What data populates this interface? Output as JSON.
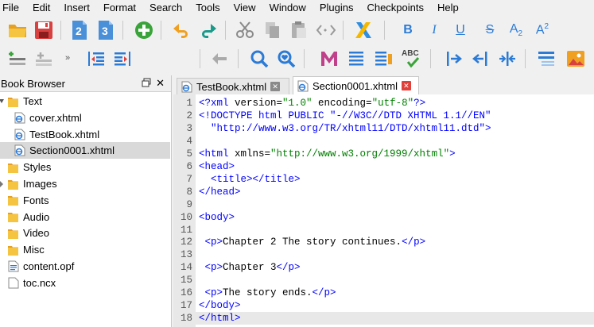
{
  "menu": [
    "File",
    "Edit",
    "Insert",
    "Format",
    "Search",
    "Tools",
    "View",
    "Window",
    "Plugins",
    "Checkpoints",
    "Help"
  ],
  "toolbar1_icons": [
    "open-folder-icon",
    "save-icon",
    "heading-2-icon",
    "heading-3-icon",
    "add-file-icon",
    "undo-icon",
    "redo-icon",
    "cut-icon",
    "copy-icon",
    "paste-icon",
    "code-view-icon",
    "x-logo-icon",
    "bold-icon",
    "italic-icon",
    "underline-icon",
    "strikethrough-icon",
    "subscript-icon",
    "superscript-icon"
  ],
  "toolbar1_labels": {
    "h2": "2",
    "h3": "3",
    "bold": "B",
    "italic": "I",
    "underline": "U",
    "strike": "S",
    "sub": "A",
    "sub_mark": "2",
    "sup": "A",
    "sup_mark": "2"
  },
  "toolbar2_icons": [
    "insert-row-icon",
    "remove-row-icon",
    "more-chevron-icon",
    "decrease-indent-icon",
    "increase-indent-icon",
    "back-arrow-icon",
    "search-icon",
    "search-heart-icon",
    "metadata-m-icon",
    "list-icon",
    "list-marker-icon",
    "spellcheck-icon",
    "split-icon",
    "merge-left-icon",
    "merge-right-icon",
    "toc-icon",
    "image-icon"
  ],
  "toolbar2_labels": {
    "spell": "ABC",
    "more": "»"
  },
  "book_browser": {
    "title": "Book Browser",
    "close": "✕",
    "items": [
      {
        "label": "Text",
        "type": "folder",
        "expanded": true
      },
      {
        "label": "cover.xhtml",
        "type": "xhtml"
      },
      {
        "label": "TestBook.xhtml",
        "type": "xhtml"
      },
      {
        "label": "Section0001.xhtml",
        "type": "xhtml",
        "selected": true
      },
      {
        "label": "Styles",
        "type": "folder"
      },
      {
        "label": "Images",
        "type": "folder",
        "has_arrow": true
      },
      {
        "label": "Fonts",
        "type": "folder"
      },
      {
        "label": "Audio",
        "type": "folder"
      },
      {
        "label": "Video",
        "type": "folder"
      },
      {
        "label": "Misc",
        "type": "folder"
      },
      {
        "label": "content.opf",
        "type": "opf"
      },
      {
        "label": "toc.ncx",
        "type": "ncx"
      }
    ]
  },
  "tabs": [
    {
      "label": "TestBook.xhtml",
      "active": false,
      "close": "✕"
    },
    {
      "label": "Section0001.xhtml",
      "active": true,
      "close": "✕"
    }
  ],
  "code_lines": [
    {
      "n": "1",
      "parts": [
        [
          "tag",
          "<?xml "
        ],
        [
          "attr",
          "version="
        ],
        [
          "str",
          "\"1.0\""
        ],
        [
          "attr",
          " encoding="
        ],
        [
          "str",
          "\"utf-8\""
        ],
        [
          "tag",
          "?>"
        ]
      ]
    },
    {
      "n": "2",
      "parts": [
        [
          "tag",
          "<!DOCTYPE html PUBLIC \"-//W3C//DTD XHTML 1.1//EN\""
        ]
      ]
    },
    {
      "n": "3",
      "parts": [
        [
          "tag",
          "  \"http://www.w3.org/TR/xhtml11/DTD/xhtml11.dtd\">"
        ]
      ]
    },
    {
      "n": "4",
      "parts": []
    },
    {
      "n": "5",
      "parts": [
        [
          "tag",
          "<html "
        ],
        [
          "attr",
          "xmlns="
        ],
        [
          "str",
          "\"http://www.w3.org/1999/xhtml\""
        ],
        [
          "tag",
          ">"
        ]
      ]
    },
    {
      "n": "6",
      "parts": [
        [
          "tag",
          "<head>"
        ]
      ]
    },
    {
      "n": "7",
      "parts": [
        [
          "tag",
          "  <title></title>"
        ]
      ]
    },
    {
      "n": "8",
      "parts": [
        [
          "tag",
          "</head>"
        ]
      ]
    },
    {
      "n": "9",
      "parts": []
    },
    {
      "n": "10",
      "parts": [
        [
          "tag",
          "<body>"
        ]
      ]
    },
    {
      "n": "11",
      "parts": []
    },
    {
      "n": "12",
      "parts": [
        [
          "tag",
          " <p>"
        ],
        [
          "txt",
          "Chapter 2 The story continues."
        ],
        [
          "tag",
          "</p>"
        ]
      ]
    },
    {
      "n": "13",
      "parts": []
    },
    {
      "n": "14",
      "parts": [
        [
          "tag",
          " <p>"
        ],
        [
          "txt",
          "Chapter 3"
        ],
        [
          "tag",
          "</p>"
        ]
      ]
    },
    {
      "n": "15",
      "parts": []
    },
    {
      "n": "16",
      "parts": [
        [
          "tag",
          " <p>"
        ],
        [
          "txt",
          "The story ends."
        ],
        [
          "tag",
          "</p>"
        ]
      ]
    },
    {
      "n": "17",
      "parts": [
        [
          "tag",
          "</body>"
        ]
      ]
    },
    {
      "n": "18",
      "parts": [
        [
          "tag",
          "</html>"
        ]
      ],
      "current": true
    }
  ],
  "colors": {
    "tag": "#0000ff",
    "string": "#008000",
    "accent_blue": "#2b7bd6",
    "close_red": "#e0403a",
    "folder": "#f5c542"
  }
}
